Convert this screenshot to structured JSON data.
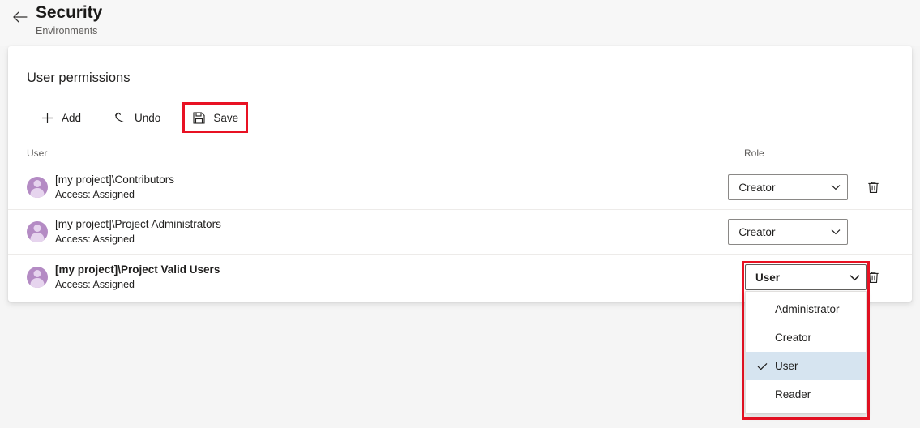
{
  "header": {
    "back_icon": "arrow-left-icon",
    "title": "Security",
    "subtitle": "Environments"
  },
  "card": {
    "title": "User permissions",
    "toolbar": {
      "add": {
        "label": "Add",
        "icon": "plus-icon"
      },
      "undo": {
        "label": "Undo",
        "icon": "undo-icon"
      },
      "save": {
        "label": "Save",
        "icon": "save-floppy-icon",
        "highlighted": true
      }
    },
    "table": {
      "columns": {
        "user": "User",
        "role": "Role"
      },
      "rows": [
        {
          "avatar": "group-avatar-icon",
          "name": "[my project]\\Contributors",
          "access": "Access: Assigned",
          "role": "Creator",
          "bold": false,
          "has_delete": true,
          "delete_icon": "trash-icon"
        },
        {
          "avatar": "group-avatar-icon",
          "name": "[my project]\\Project Administrators",
          "access": "Access: Assigned",
          "role": "Creator",
          "bold": false,
          "has_delete": false,
          "delete_icon": ""
        },
        {
          "avatar": "group-avatar-icon",
          "name": "[my project]\\Project Valid Users",
          "access": "Access: Assigned",
          "role": "User",
          "bold": true,
          "has_delete": true,
          "delete_icon": "trash-icon"
        }
      ]
    }
  },
  "role_dropdown": {
    "selected": "User",
    "chevron_icon": "chevron-down-icon",
    "open": true,
    "highlighted": true,
    "options": [
      {
        "label": "Administrator",
        "selected": false
      },
      {
        "label": "Creator",
        "selected": false
      },
      {
        "label": "User",
        "selected": true
      },
      {
        "label": "Reader",
        "selected": false
      }
    ]
  },
  "colors": {
    "highlight_red": "#e81123",
    "avatar_purple": "#b48bc4",
    "menu_selected_bg": "#d6e4f0",
    "page_bg": "#f5f5f5",
    "card_bg": "#ffffff"
  }
}
